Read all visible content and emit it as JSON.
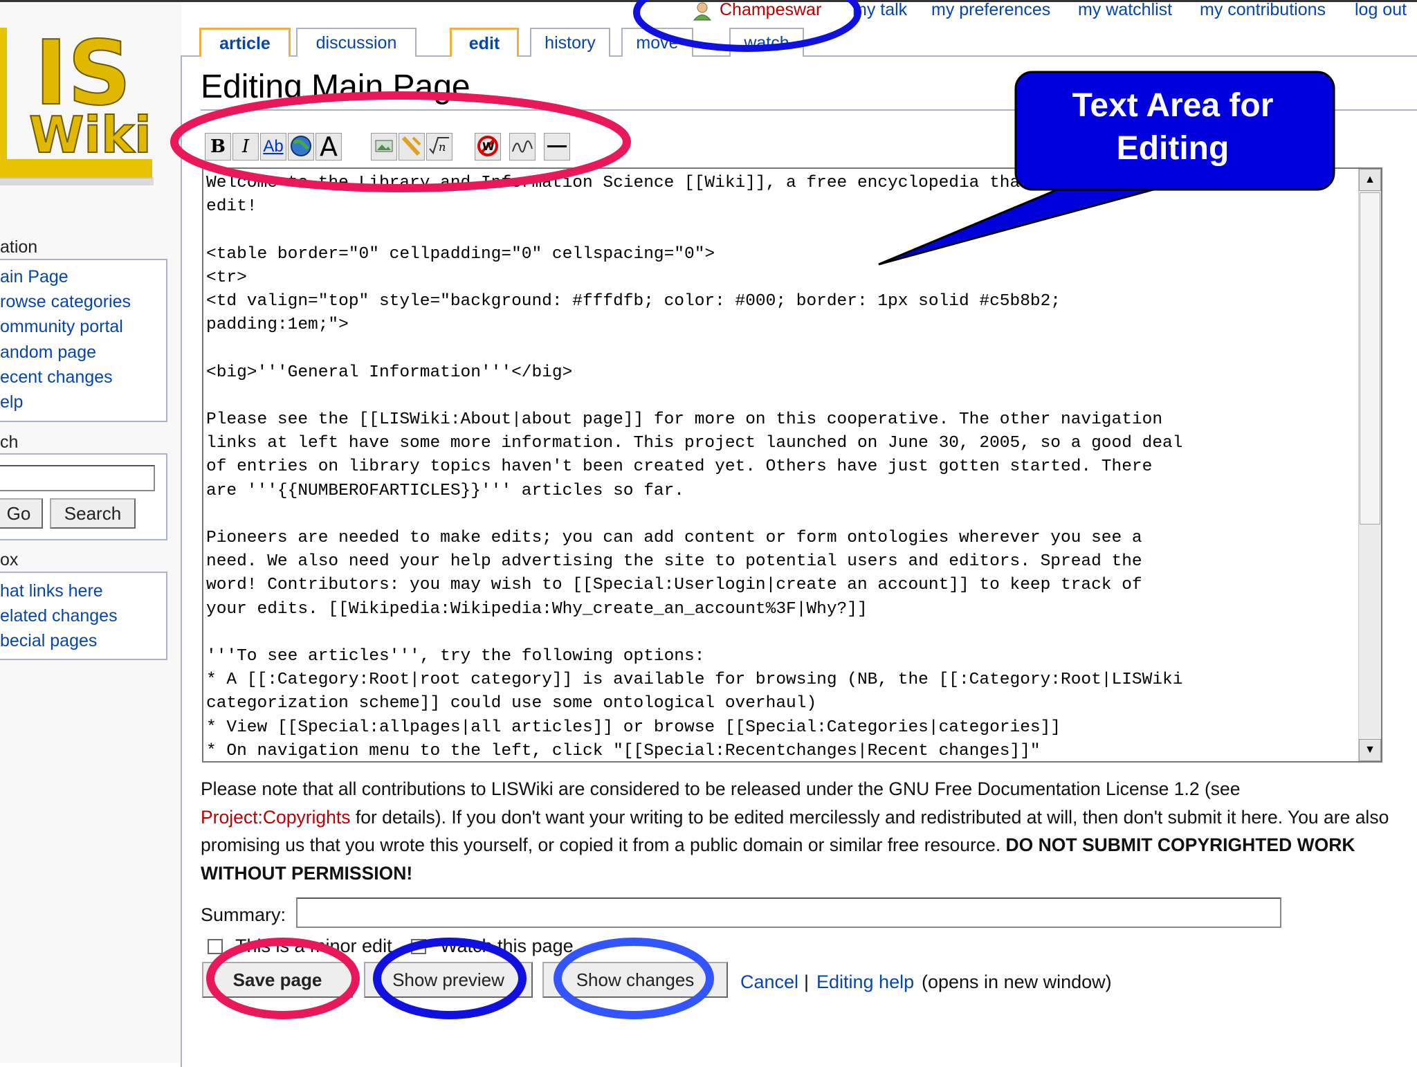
{
  "user_links": {
    "username": "Champeswar",
    "talk": "my talk",
    "preferences": "my preferences",
    "watchlist": "my watchlist",
    "contributions": "my contributions",
    "logout": "log out"
  },
  "logo": {
    "line1": "IS",
    "line2": "Wiki"
  },
  "tabs": {
    "article": "article",
    "discussion": "discussion",
    "edit": "edit",
    "history": "history",
    "move": "move",
    "watch": "watch"
  },
  "sidebar": {
    "navigation_heading": "ation",
    "navigation_items": [
      "ain Page",
      "rowse categories",
      "ommunity portal",
      "andom page",
      "ecent changes",
      "elp"
    ],
    "search_heading": "ch",
    "go_label": "Go",
    "search_label": "Search",
    "toolbox_heading": "ox",
    "toolbox_items": [
      "hat links here",
      "elated changes",
      "becial pages"
    ]
  },
  "page": {
    "title": "Editing Main Page"
  },
  "toolbar": {
    "bold": "B",
    "italic": "I",
    "link": "Ab",
    "font": "A"
  },
  "editor": {
    "text": "Welcome to the Library and Information Science [[Wiki]], a free encyclopedia that anyone can\nedit!\n\n<table border=\"0\" cellpadding=\"0\" cellspacing=\"0\">\n<tr>\n<td valign=\"top\" style=\"background: #fffdfb; color: #000; border: 1px solid #c5b8b2;\npadding:1em;\">\n\n<big>'''General Information'''</big>\n\nPlease see the [[LISWiki:About|about page]] for more on this cooperative. The other navigation\nlinks at left have some more information. This project launched on June 30, 2005, so a good deal\nof entries on library topics haven't been created yet. Others have just gotten started. There\nare '''{{NUMBEROFARTICLES}}''' articles so far.\n\nPioneers are needed to make edits; you can add content or form ontologies wherever you see a\nneed. We also need your help advertising the site to potential users and editors. Spread the\nword! Contributors: you may wish to [[Special:Userlogin|create an account]] to keep track of\nyour edits. [[Wikipedia:Wikipedia:Why_create_an_account%3F|Why?]]\n\n'''To see articles''', try the following options:\n* A [[:Category:Root|root category]] is available for browsing (NB, the [[:Category:Root|LISWiki\ncategorization scheme]] could use some ontological overhaul)\n* View [[Special:allpages|all articles]] or browse [[Special:Categories|categories]]\n* On navigation menu to the left, click \"[[Special:Recentchanges|Recent changes]]\""
  },
  "notice": {
    "part1": "Please note that all contributions to LISWiki are considered to be released under the GNU Free Documentation License 1.2 (see ",
    "link": "Project:Copyrights",
    "part2": " for details). If you don't want your writing to be edited mercilessly and redistributed at will, then don't submit it here. You are also promising us that you wrote this yourself, or copied it from a public domain or similar free resource. ",
    "bold": "DO NOT SUBMIT COPYRIGHTED WORK WITHOUT PERMISSION!"
  },
  "form": {
    "summary_label": "Summary:",
    "minor_edit_label": "This is a minor edit",
    "watch_label": "Watch this page",
    "save_label": "Save page",
    "preview_label": "Show preview",
    "changes_label": "Show changes",
    "cancel_label": "Cancel",
    "separator": "|",
    "help_label": "Editing help",
    "help_note": "(opens in new window)"
  },
  "annotation": {
    "callout_text": "Text Area for Editing",
    "colors": {
      "callout_fill": "#0000dd",
      "red_ellipse": "#e8185a",
      "blue_ellipse": "#1010e0",
      "light_blue_ellipse": "#3355ff"
    }
  }
}
